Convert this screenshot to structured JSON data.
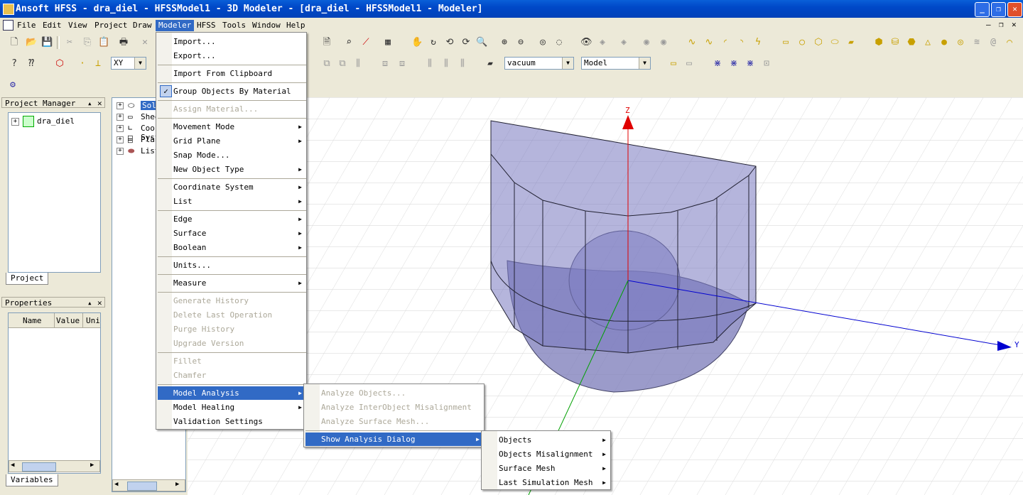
{
  "window": {
    "title": "Ansoft HFSS - dra_diel - HFSSModel1 - 3D Modeler - [dra_diel - HFSSModel1 - Modeler]"
  },
  "menubar": [
    "File",
    "Edit",
    "View",
    "Project",
    "Draw",
    "Modeler",
    "HFSS",
    "Tools",
    "Window",
    "Help"
  ],
  "toolbar": {
    "plane_value": "XY",
    "material_value": "vacuum",
    "mode_value": "Model"
  },
  "project_manager": {
    "title": "Project Manager",
    "root": "dra_diel",
    "tab": "Project"
  },
  "tree": {
    "items": [
      "Solids",
      "Sheets",
      "Coordinate Systems",
      "Planes",
      "Lists"
    ]
  },
  "properties": {
    "title": "Properties",
    "cols": [
      "Name",
      "Value",
      "Unit"
    ],
    "tab": "Variables"
  },
  "modeler_menu": {
    "items": [
      {
        "label": "Import...",
        "sub": false,
        "dis": false
      },
      {
        "label": "Export...",
        "sub": false,
        "dis": false
      },
      {
        "sep": true
      },
      {
        "label": "Import From Clipboard",
        "sub": false,
        "dis": false
      },
      {
        "sep": true
      },
      {
        "label": "Group Objects By Material",
        "sub": false,
        "dis": false,
        "check": true
      },
      {
        "sep": true
      },
      {
        "label": "Assign Material...",
        "sub": false,
        "dis": true
      },
      {
        "sep": true
      },
      {
        "label": "Movement Mode",
        "sub": true,
        "dis": false
      },
      {
        "label": "Grid Plane",
        "sub": true,
        "dis": false
      },
      {
        "label": "Snap Mode...",
        "sub": false,
        "dis": false
      },
      {
        "label": "New Object Type",
        "sub": true,
        "dis": false
      },
      {
        "sep": true
      },
      {
        "label": "Coordinate System",
        "sub": true,
        "dis": false
      },
      {
        "label": "List",
        "sub": true,
        "dis": false
      },
      {
        "sep": true
      },
      {
        "label": "Edge",
        "sub": true,
        "dis": false
      },
      {
        "label": "Surface",
        "sub": true,
        "dis": false
      },
      {
        "label": "Boolean",
        "sub": true,
        "dis": false
      },
      {
        "sep": true
      },
      {
        "label": "Units...",
        "sub": false,
        "dis": false
      },
      {
        "sep": true
      },
      {
        "label": "Measure",
        "sub": true,
        "dis": false
      },
      {
        "sep": true
      },
      {
        "label": "Generate History",
        "sub": false,
        "dis": true
      },
      {
        "label": "Delete Last Operation",
        "sub": false,
        "dis": true
      },
      {
        "label": "Purge History",
        "sub": false,
        "dis": true
      },
      {
        "label": "Upgrade Version",
        "sub": false,
        "dis": true
      },
      {
        "sep": true
      },
      {
        "label": "Fillet",
        "sub": false,
        "dis": true
      },
      {
        "label": "Chamfer",
        "sub": false,
        "dis": true
      },
      {
        "sep": true
      },
      {
        "label": "Model Analysis",
        "sub": true,
        "dis": false,
        "hl": true
      },
      {
        "label": "Model Healing",
        "sub": true,
        "dis": false
      },
      {
        "label": "Validation Settings",
        "sub": false,
        "dis": false
      }
    ]
  },
  "analysis_menu": {
    "items": [
      {
        "label": "Analyze Objects...",
        "dis": true
      },
      {
        "label": "Analyze InterObject Misalignment",
        "dis": true
      },
      {
        "label": "Analyze Surface Mesh...",
        "dis": true
      },
      {
        "sep": true
      },
      {
        "label": "Show Analysis Dialog",
        "dis": false,
        "hl": true,
        "sub": true
      }
    ]
  },
  "dialog_menu": {
    "items": [
      "Objects",
      "Objects Misalignment",
      "Surface Mesh",
      "Last Simulation Mesh"
    ]
  },
  "axes": {
    "z": "Z",
    "y": "Y"
  },
  "colors": {
    "accent": "#316ac5",
    "model_fill": "#7070b8",
    "zaxis": "#e00000",
    "yaxis": "#0000d0",
    "xaxis": "#00a000"
  }
}
